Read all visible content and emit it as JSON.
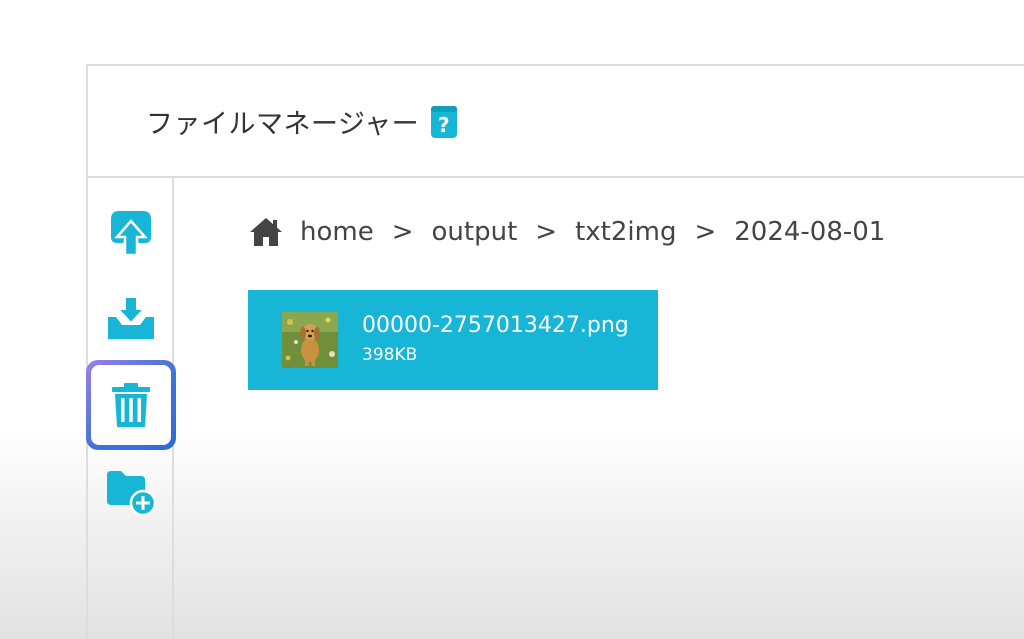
{
  "app": {
    "title": "ファイルマネージャー"
  },
  "colors": {
    "accent": "#17b6d6",
    "selection_border": "#3f74d8"
  },
  "toolbar": {
    "items": [
      {
        "name": "upload",
        "icon": "upload-cloud-icon"
      },
      {
        "name": "download",
        "icon": "download-tray-icon"
      },
      {
        "name": "delete",
        "icon": "trash-icon",
        "selected": true
      },
      {
        "name": "new-folder",
        "icon": "folder-plus-icon"
      }
    ]
  },
  "breadcrumb": {
    "icon": "home-icon",
    "separator": ">",
    "items": [
      "home",
      "output",
      "txt2img",
      "2024-08-01"
    ]
  },
  "files": [
    {
      "name": "00000-2757013427.png",
      "size": "398KB",
      "thumbnail": "puppy-image-thumbnail"
    }
  ]
}
